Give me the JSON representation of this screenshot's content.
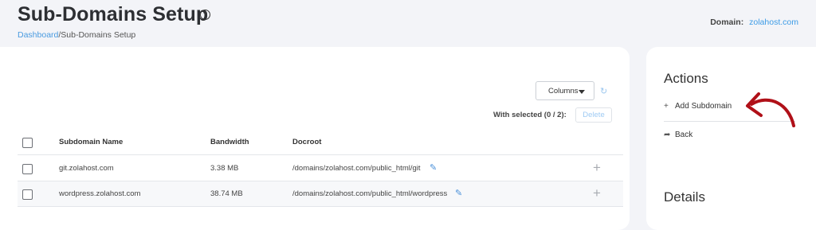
{
  "header": {
    "title": "Sub-Domains Setup",
    "help_icon": "question-circle-icon",
    "breadcrumb": {
      "home": "Dashboard",
      "separator": "/",
      "current": "Sub-Domains Setup"
    },
    "domain_label": "Domain:",
    "domain_value": "zolahost.com"
  },
  "toolbar": {
    "columns_label": "Columns",
    "with_selected": "With selected (0 / 2):",
    "delete_label": "Delete"
  },
  "table": {
    "columns": [
      "Subdomain Name",
      "Bandwidth",
      "Docroot"
    ],
    "rows": [
      {
        "name": "git.zolahost.com",
        "bandwidth": "3.38 MB",
        "docroot": "/domains/zolahost.com/public_html/git"
      },
      {
        "name": "wordpress.zolahost.com",
        "bandwidth": "38.74 MB",
        "docroot": "/domains/zolahost.com/public_html/wordpress"
      }
    ]
  },
  "sidebar": {
    "actions_title": "Actions",
    "items": [
      {
        "label": "Add Subdomain",
        "icon": "plus-icon"
      },
      {
        "label": "Back",
        "icon": "share-arrow-icon"
      }
    ],
    "details_title": "Details"
  },
  "colors": {
    "accent": "#3c9be6",
    "annotation_arrow": "#b01018",
    "page_bg": "#f3f4f8"
  }
}
